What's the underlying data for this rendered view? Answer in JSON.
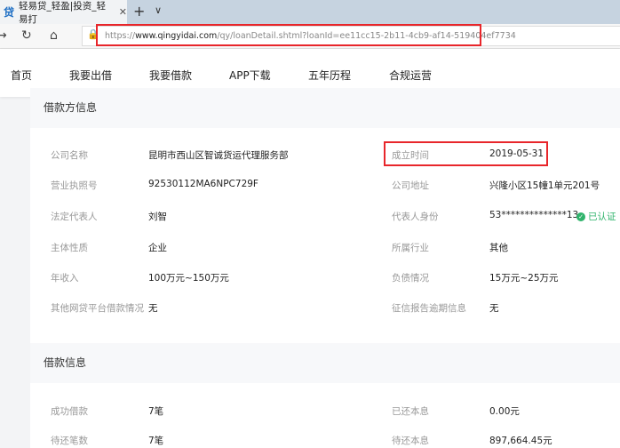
{
  "browser": {
    "tab_title": "轻易贷_轻盈|投资_轻易打",
    "url_prefix": "https://",
    "url_domain": "www.qingyidai.com",
    "url_path": "/qy/loanDetail.shtml?loanId=ee11cc15-2b11-4cb9-af14-519404ef7734"
  },
  "nav": [
    "首页",
    "我要出借",
    "我要借款",
    "APP下载",
    "五年历程",
    "合规运营"
  ],
  "borrower": {
    "title": "借款方信息",
    "left": [
      {
        "label": "公司名称",
        "value": "昆明市西山区智诚货运代理服务部"
      },
      {
        "label": "营业执照号",
        "value": "92530112MA6NPC729F"
      },
      {
        "label": "法定代表人",
        "value": "刘智"
      },
      {
        "label": "主体性质",
        "value": "企业"
      },
      {
        "label": "年收入",
        "value": "100万元~150万元"
      },
      {
        "label": "其他网贷平台借款情况",
        "value": "无"
      }
    ],
    "right": [
      {
        "label": "成立时间",
        "value": "2019-05-31"
      },
      {
        "label": "公司地址",
        "value": "兴隆小区15幢1单元201号"
      },
      {
        "label": "代表人身份",
        "value": "53**************13"
      },
      {
        "label": "所属行业",
        "value": "其他"
      },
      {
        "label": "负债情况",
        "value": "15万元~25万元"
      },
      {
        "label": "征信报告逾期信息",
        "value": "无"
      }
    ],
    "verified": "已认证"
  },
  "loan": {
    "title": "借款信息",
    "left": [
      {
        "label": "成功借款",
        "value": "7笔"
      },
      {
        "label": "待还笔数",
        "value": "7笔"
      }
    ],
    "right": [
      {
        "label": "已还本息",
        "value": "0.00元"
      },
      {
        "label": "待还本息",
        "value": "897,664.45元"
      }
    ]
  }
}
